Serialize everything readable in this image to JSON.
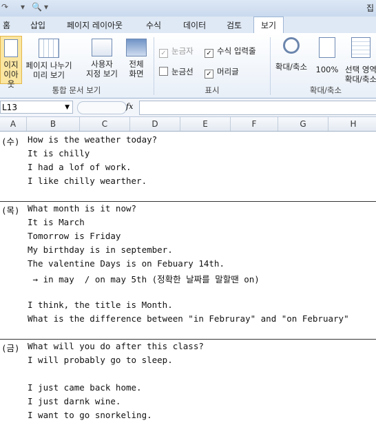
{
  "title_right": "집",
  "tabs": [
    "홈",
    "삽입",
    "페이지 레이아웃",
    "수식",
    "데이터",
    "검토",
    "보기"
  ],
  "ribbon": {
    "views": {
      "page_layout": [
        "이지",
        "이아웃"
      ],
      "page_break": [
        "페이지 나누기",
        "미리 보기"
      ],
      "custom": [
        "사용자",
        "지정 보기"
      ],
      "full": [
        "전체",
        "화면"
      ],
      "label": "통합 문서 보기"
    },
    "show": {
      "ruler": "눈금자",
      "formula_bar": "수식 입력줄",
      "gridlines": "눈금선",
      "headings": "머리글",
      "label": "표시"
    },
    "zoom": {
      "zoom": "확대/축소",
      "hundred": "100%",
      "selection": [
        "선택 영역",
        "확대/축소"
      ],
      "label": "확대/축소"
    }
  },
  "namebox": "L13",
  "fx": "fx",
  "columns": [
    "A",
    "B",
    "C",
    "D",
    "E",
    "F",
    "G",
    "H"
  ],
  "blocks": [
    {
      "day": "(수)",
      "lines": [
        "How is the weather today?",
        "It is chilly",
        "I had a lof of work.",
        "I like chilly wearther."
      ]
    },
    {
      "day": "(목)",
      "lines": [
        "What month is it now?",
        "It is March",
        "Tomorrow is Friday",
        "My birthday is in september.",
        "The valentine Days is on Febuary 14th.",
        " → in may  / on may 5th (정확한 날짜를 말할땐 on)",
        "",
        "I think, the title is Month.",
        "What is the difference between \"in Februray\" and \"on February\""
      ]
    },
    {
      "day": "(금)",
      "lines": [
        "What will you do after this class?",
        "I will probably go to sleep.",
        "",
        "I just came back home.",
        "I just darnk wine.",
        "I want to go snorkeling."
      ]
    }
  ]
}
